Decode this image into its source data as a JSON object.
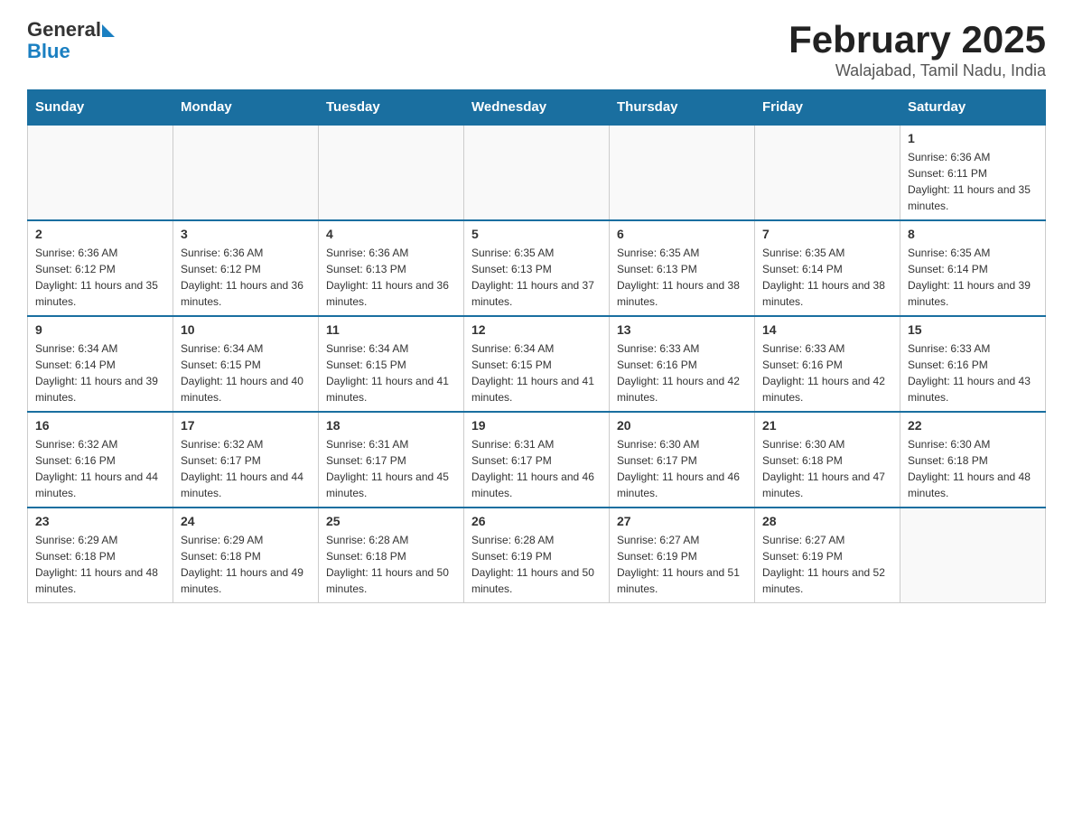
{
  "header": {
    "logo_general": "General",
    "logo_blue": "Blue",
    "month_title": "February 2025",
    "location": "Walajabad, Tamil Nadu, India"
  },
  "days_of_week": [
    "Sunday",
    "Monday",
    "Tuesday",
    "Wednesday",
    "Thursday",
    "Friday",
    "Saturday"
  ],
  "weeks": [
    [
      {
        "day": "",
        "sunrise": "",
        "sunset": "",
        "daylight": ""
      },
      {
        "day": "",
        "sunrise": "",
        "sunset": "",
        "daylight": ""
      },
      {
        "day": "",
        "sunrise": "",
        "sunset": "",
        "daylight": ""
      },
      {
        "day": "",
        "sunrise": "",
        "sunset": "",
        "daylight": ""
      },
      {
        "day": "",
        "sunrise": "",
        "sunset": "",
        "daylight": ""
      },
      {
        "day": "",
        "sunrise": "",
        "sunset": "",
        "daylight": ""
      },
      {
        "day": "1",
        "sunrise": "Sunrise: 6:36 AM",
        "sunset": "Sunset: 6:11 PM",
        "daylight": "Daylight: 11 hours and 35 minutes."
      }
    ],
    [
      {
        "day": "2",
        "sunrise": "Sunrise: 6:36 AM",
        "sunset": "Sunset: 6:12 PM",
        "daylight": "Daylight: 11 hours and 35 minutes."
      },
      {
        "day": "3",
        "sunrise": "Sunrise: 6:36 AM",
        "sunset": "Sunset: 6:12 PM",
        "daylight": "Daylight: 11 hours and 36 minutes."
      },
      {
        "day": "4",
        "sunrise": "Sunrise: 6:36 AM",
        "sunset": "Sunset: 6:13 PM",
        "daylight": "Daylight: 11 hours and 36 minutes."
      },
      {
        "day": "5",
        "sunrise": "Sunrise: 6:35 AM",
        "sunset": "Sunset: 6:13 PM",
        "daylight": "Daylight: 11 hours and 37 minutes."
      },
      {
        "day": "6",
        "sunrise": "Sunrise: 6:35 AM",
        "sunset": "Sunset: 6:13 PM",
        "daylight": "Daylight: 11 hours and 38 minutes."
      },
      {
        "day": "7",
        "sunrise": "Sunrise: 6:35 AM",
        "sunset": "Sunset: 6:14 PM",
        "daylight": "Daylight: 11 hours and 38 minutes."
      },
      {
        "day": "8",
        "sunrise": "Sunrise: 6:35 AM",
        "sunset": "Sunset: 6:14 PM",
        "daylight": "Daylight: 11 hours and 39 minutes."
      }
    ],
    [
      {
        "day": "9",
        "sunrise": "Sunrise: 6:34 AM",
        "sunset": "Sunset: 6:14 PM",
        "daylight": "Daylight: 11 hours and 39 minutes."
      },
      {
        "day": "10",
        "sunrise": "Sunrise: 6:34 AM",
        "sunset": "Sunset: 6:15 PM",
        "daylight": "Daylight: 11 hours and 40 minutes."
      },
      {
        "day": "11",
        "sunrise": "Sunrise: 6:34 AM",
        "sunset": "Sunset: 6:15 PM",
        "daylight": "Daylight: 11 hours and 41 minutes."
      },
      {
        "day": "12",
        "sunrise": "Sunrise: 6:34 AM",
        "sunset": "Sunset: 6:15 PM",
        "daylight": "Daylight: 11 hours and 41 minutes."
      },
      {
        "day": "13",
        "sunrise": "Sunrise: 6:33 AM",
        "sunset": "Sunset: 6:16 PM",
        "daylight": "Daylight: 11 hours and 42 minutes."
      },
      {
        "day": "14",
        "sunrise": "Sunrise: 6:33 AM",
        "sunset": "Sunset: 6:16 PM",
        "daylight": "Daylight: 11 hours and 42 minutes."
      },
      {
        "day": "15",
        "sunrise": "Sunrise: 6:33 AM",
        "sunset": "Sunset: 6:16 PM",
        "daylight": "Daylight: 11 hours and 43 minutes."
      }
    ],
    [
      {
        "day": "16",
        "sunrise": "Sunrise: 6:32 AM",
        "sunset": "Sunset: 6:16 PM",
        "daylight": "Daylight: 11 hours and 44 minutes."
      },
      {
        "day": "17",
        "sunrise": "Sunrise: 6:32 AM",
        "sunset": "Sunset: 6:17 PM",
        "daylight": "Daylight: 11 hours and 44 minutes."
      },
      {
        "day": "18",
        "sunrise": "Sunrise: 6:31 AM",
        "sunset": "Sunset: 6:17 PM",
        "daylight": "Daylight: 11 hours and 45 minutes."
      },
      {
        "day": "19",
        "sunrise": "Sunrise: 6:31 AM",
        "sunset": "Sunset: 6:17 PM",
        "daylight": "Daylight: 11 hours and 46 minutes."
      },
      {
        "day": "20",
        "sunrise": "Sunrise: 6:30 AM",
        "sunset": "Sunset: 6:17 PM",
        "daylight": "Daylight: 11 hours and 46 minutes."
      },
      {
        "day": "21",
        "sunrise": "Sunrise: 6:30 AM",
        "sunset": "Sunset: 6:18 PM",
        "daylight": "Daylight: 11 hours and 47 minutes."
      },
      {
        "day": "22",
        "sunrise": "Sunrise: 6:30 AM",
        "sunset": "Sunset: 6:18 PM",
        "daylight": "Daylight: 11 hours and 48 minutes."
      }
    ],
    [
      {
        "day": "23",
        "sunrise": "Sunrise: 6:29 AM",
        "sunset": "Sunset: 6:18 PM",
        "daylight": "Daylight: 11 hours and 48 minutes."
      },
      {
        "day": "24",
        "sunrise": "Sunrise: 6:29 AM",
        "sunset": "Sunset: 6:18 PM",
        "daylight": "Daylight: 11 hours and 49 minutes."
      },
      {
        "day": "25",
        "sunrise": "Sunrise: 6:28 AM",
        "sunset": "Sunset: 6:18 PM",
        "daylight": "Daylight: 11 hours and 50 minutes."
      },
      {
        "day": "26",
        "sunrise": "Sunrise: 6:28 AM",
        "sunset": "Sunset: 6:19 PM",
        "daylight": "Daylight: 11 hours and 50 minutes."
      },
      {
        "day": "27",
        "sunrise": "Sunrise: 6:27 AM",
        "sunset": "Sunset: 6:19 PM",
        "daylight": "Daylight: 11 hours and 51 minutes."
      },
      {
        "day": "28",
        "sunrise": "Sunrise: 6:27 AM",
        "sunset": "Sunset: 6:19 PM",
        "daylight": "Daylight: 11 hours and 52 minutes."
      },
      {
        "day": "",
        "sunrise": "",
        "sunset": "",
        "daylight": ""
      }
    ]
  ]
}
